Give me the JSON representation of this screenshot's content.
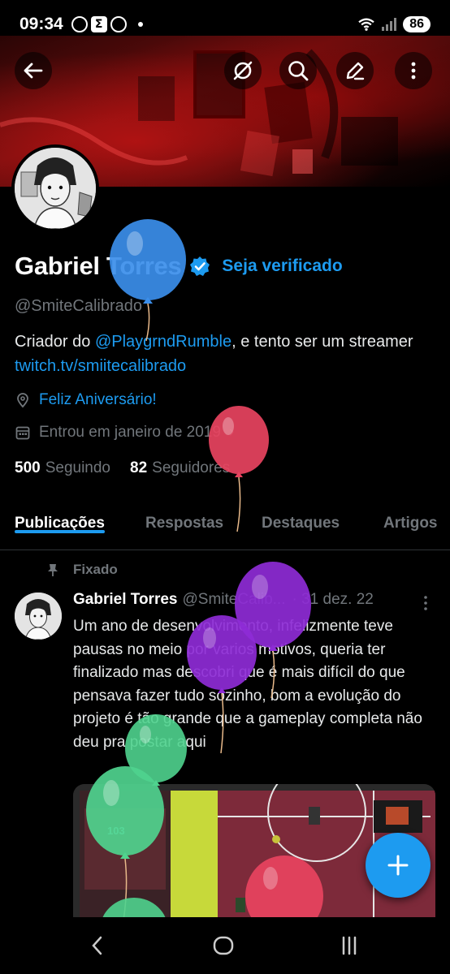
{
  "status_bar": {
    "time": "09:34",
    "battery": "86",
    "app_icons": [
      "whatsapp-icon",
      "sigma-app-icon",
      "whatsapp-icon"
    ]
  },
  "header": {
    "back_icon": "back-arrow-icon",
    "actions": [
      "grok-icon",
      "search-icon",
      "edit-icon",
      "more-icon"
    ]
  },
  "profile": {
    "display_name": "Gabriel Torres",
    "get_verified": "Seja verificado",
    "handle": "@SmiteCalibrado",
    "bio_prefix": "Criador do ",
    "bio_mention": "@PlaygrndRumble",
    "bio_middle": ", e tento ser um streamer ",
    "bio_link": "twitch.tv/smiitecalibrado",
    "birthday": "Feliz Aniversário!",
    "joined": "Entrou em janeiro de 2019",
    "following_count": "500",
    "following_label": "Seguindo",
    "followers_count": "82",
    "followers_label": "Seguidores"
  },
  "tabs": [
    {
      "label": "Publicações",
      "active": true
    },
    {
      "label": "Respostas",
      "active": false
    },
    {
      "label": "Destaques",
      "active": false
    },
    {
      "label": "Artigos",
      "active": false
    }
  ],
  "post": {
    "pinned_label": "Fixado",
    "author_name": "Gabriel Torres",
    "author_handle": "@SmiteCalib...",
    "date": "· 31 dez. 22",
    "text": "Um ano de desenvolvimento, infelizmente teve pausas no meio por varios motivos, queria ter finalizado mas descobri que é mais difícil do que pensava fazer tudo sozinho, bom a evolução do projeto é tão grande que a gameplay completa não deu pra postar aqui",
    "media_counter": "103"
  },
  "colors": {
    "accent": "#1d9bf0",
    "muted": "#71767b",
    "balloon_blue": "#3b8eea",
    "balloon_red": "#e8435f",
    "balloon_purple": "#8e2bd6",
    "balloon_green": "#4fd38e"
  }
}
